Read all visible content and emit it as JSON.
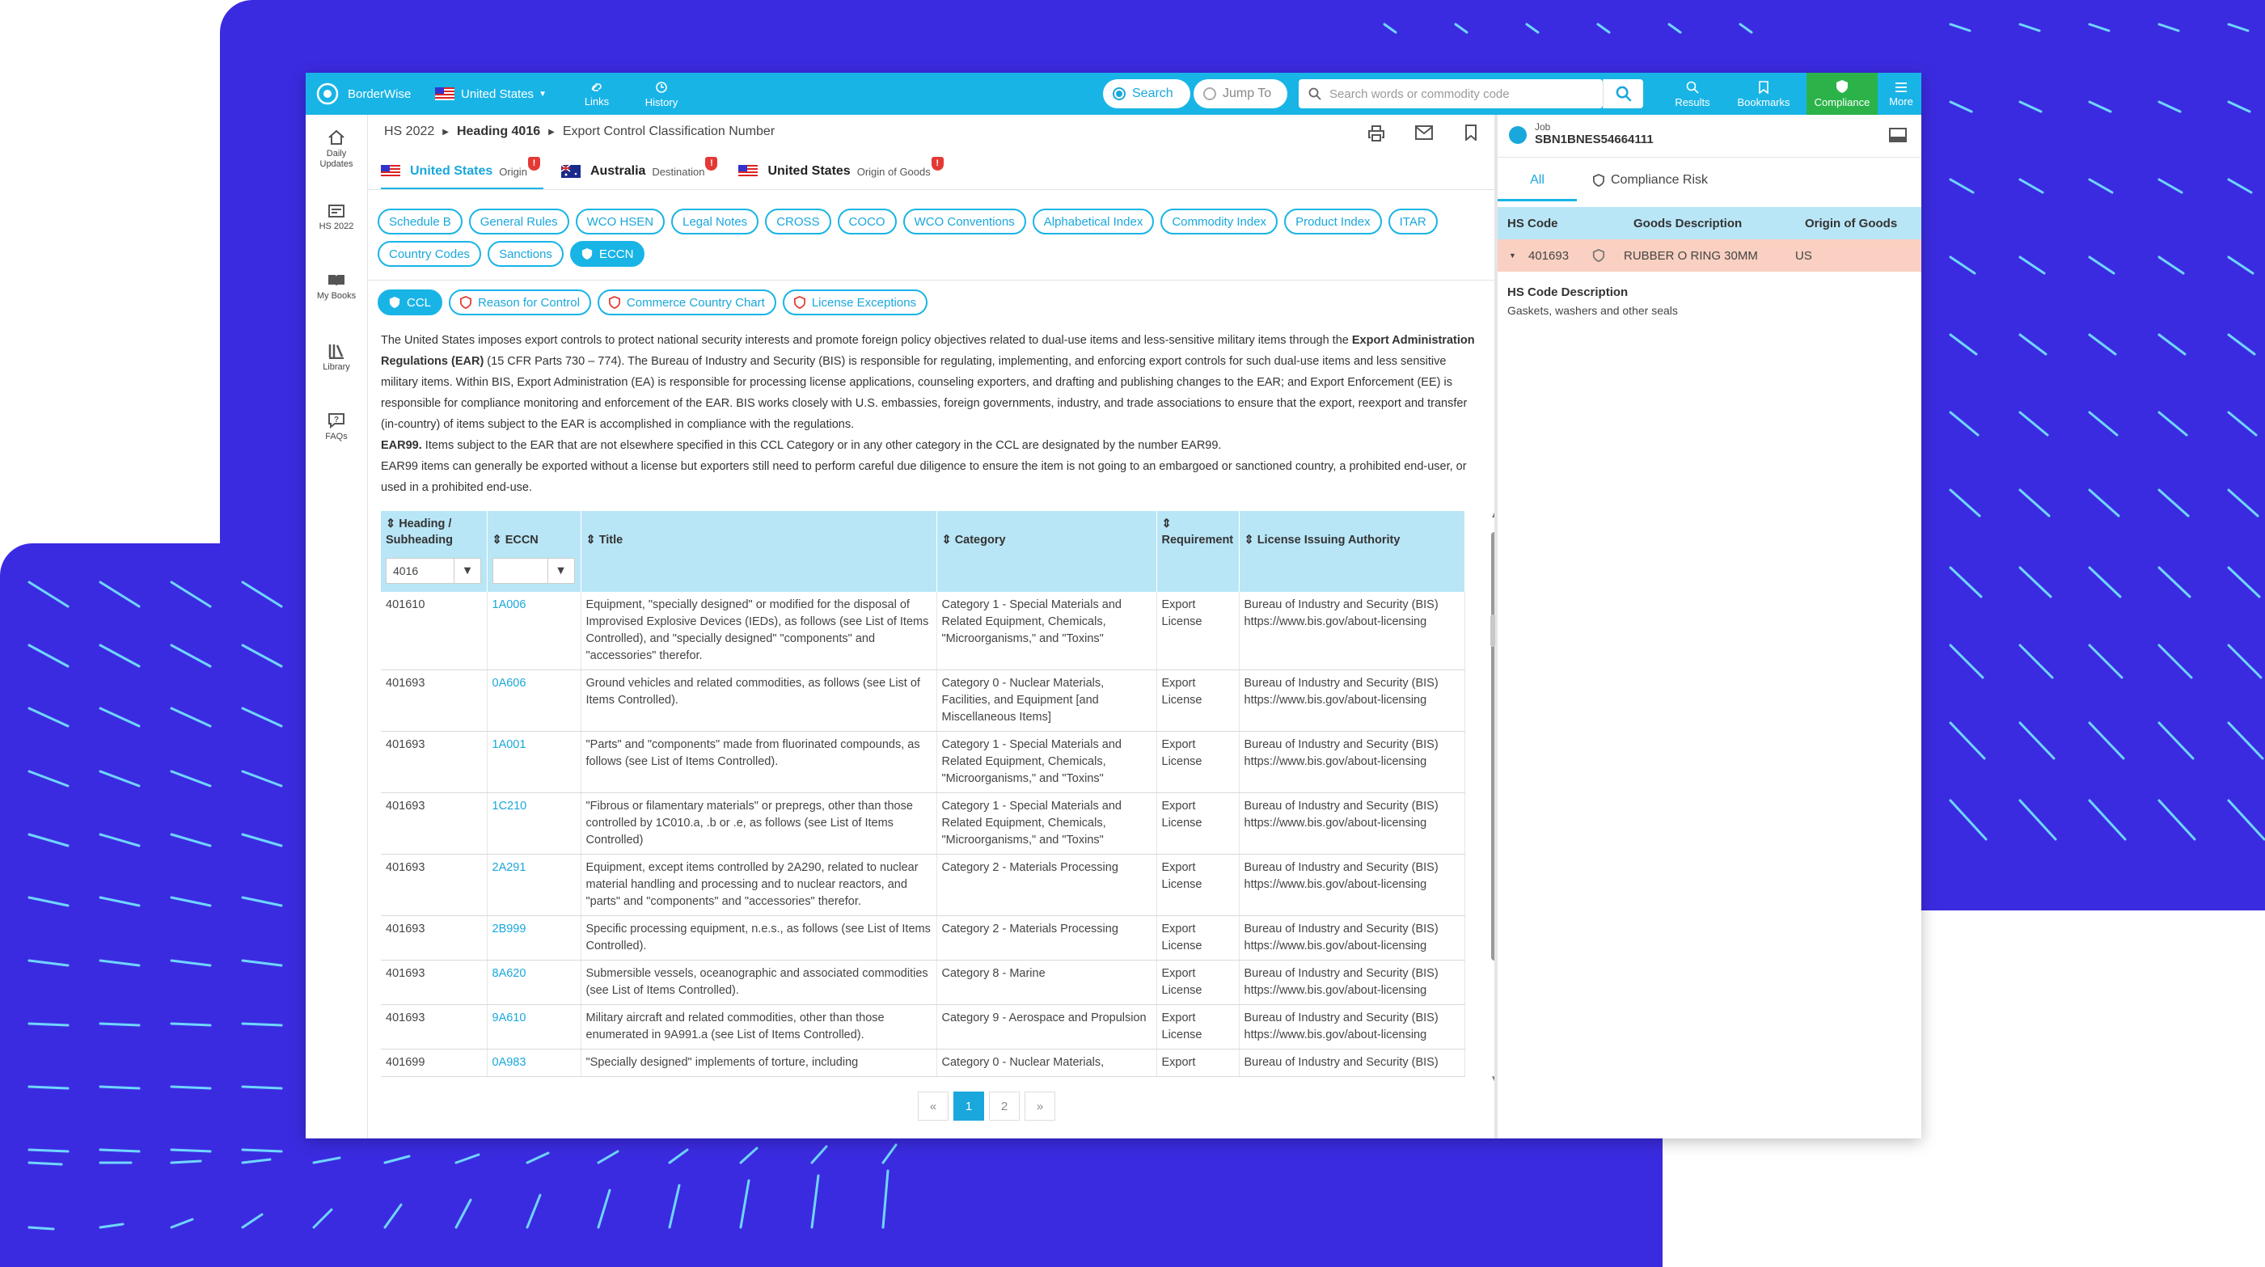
{
  "brand": {
    "name": "BorderWise"
  },
  "topbar": {
    "country": "United States",
    "links": "Links",
    "history": "History",
    "search_radio": "Search",
    "jump_radio": "Jump To",
    "search_placeholder": "Search words or commodity code",
    "results": "Results",
    "bookmarks": "Bookmarks",
    "compliance": "Compliance",
    "more": "More"
  },
  "sidebar": {
    "items": [
      {
        "label": "Daily Updates",
        "icon": "home-icon"
      },
      {
        "label": "HS 2022",
        "icon": "hs-icon"
      },
      {
        "label": "My Books",
        "icon": "book-icon"
      },
      {
        "label": "Library",
        "icon": "library-icon"
      },
      {
        "label": "FAQs",
        "icon": "faq-icon"
      }
    ]
  },
  "breadcrumb": {
    "part1": "HS 2022",
    "part2": "Heading 4016",
    "part3": "Export Control Classification Number"
  },
  "origins": [
    {
      "name": "United States",
      "role": "Origin",
      "badge": "!"
    },
    {
      "name": "Australia",
      "role": "Destination",
      "badge": "!"
    },
    {
      "name": "United States",
      "role": "Origin of Goods",
      "badge": "!"
    }
  ],
  "pills": [
    "Schedule B",
    "General Rules",
    "WCO HSEN",
    "Legal Notes",
    "CROSS",
    "COCO",
    "WCO Conventions",
    "Alphabetical Index",
    "Commodity Index",
    "Product Index",
    "ITAR",
    "Country Codes",
    "Sanctions",
    "ECCN"
  ],
  "subpills": [
    "CCL",
    "Reason for Control",
    "Commerce Country Chart",
    "License Exceptions"
  ],
  "paragraph": {
    "p1a": "The United States imposes export controls to protect national security interests and promote foreign policy objectives related to dual-use items and less-sensitive military items through the ",
    "p1b": "Export Administration Regulations (EAR)",
    "p1c": " (15 CFR Parts 730 – 774). The Bureau of Industry and Security (BIS) is responsible for regulating, implementing, and enforcing export controls for such dual-use items and less sensitive military items. Within BIS, Export Administration (EA) is responsible for processing license applications, counseling exporters, and drafting and publishing changes to the EAR; and Export Enforcement (EE) is responsible for compliance monitoring and enforcement of the EAR. BIS works closely with U.S. embassies, foreign governments, industry, and trade associations to ensure that the export, reexport and transfer (in-country) of items subject to the EAR is accomplished in compliance with the regulations.",
    "p2a": "EAR99.",
    "p2b": " Items subject to the EAR that are not elsewhere specified in this CCL Category or in any other category in the CCL are designated by the number EAR99.",
    "p3": "EAR99 items can generally be exported without a license but exporters still need to perform careful due diligence to ensure the item is not going to an embargoed or sanctioned country, a prohibited end-user, or used in a prohibited end-use."
  },
  "table": {
    "headers": [
      "Heading / Subheading",
      "ECCN",
      "Title",
      "Category",
      "Requirement",
      "License Issuing Authority"
    ],
    "filter_value": "4016",
    "rows": [
      {
        "heading": "401610",
        "eccn": "1A006",
        "title": "Equipment, \"specially designed\" or modified for the disposal of Improvised Explosive Devices (IEDs), as follows (see List of Items Controlled), and \"specially designed\" \"components\" and \"accessories\" therefor.",
        "category": "Category 1 - Special Materials and Related Equipment, Chemicals, \"Microorganisms,\" and \"Toxins\"",
        "req": "Export License",
        "auth": "Bureau of Industry and Security (BIS) https://www.bis.gov/about-licensing"
      },
      {
        "heading": "401693",
        "eccn": "0A606",
        "title": "Ground vehicles and related commodities, as follows (see List of Items Controlled).",
        "category": "Category 0 - Nuclear Materials, Facilities, and Equipment [and Miscellaneous Items]",
        "req": "Export License",
        "auth": "Bureau of Industry and Security (BIS) https://www.bis.gov/about-licensing"
      },
      {
        "heading": "401693",
        "eccn": "1A001",
        "title": "\"Parts\" and \"components\" made from fluorinated compounds, as follows (see List of Items Controlled).",
        "category": "Category 1 - Special Materials and Related Equipment, Chemicals, \"Microorganisms,\" and \"Toxins\"",
        "req": "Export License",
        "auth": "Bureau of Industry and Security (BIS) https://www.bis.gov/about-licensing"
      },
      {
        "heading": "401693",
        "eccn": "1C210",
        "title": "\"Fibrous or filamentary materials\" or prepregs, other than those controlled by 1C010.a, .b or .e, as follows (see List of Items Controlled)",
        "category": "Category 1 - Special Materials and Related Equipment, Chemicals, \"Microorganisms,\" and \"Toxins\"",
        "req": "Export License",
        "auth": "Bureau of Industry and Security (BIS) https://www.bis.gov/about-licensing"
      },
      {
        "heading": "401693",
        "eccn": "2A291",
        "title": "Equipment, except items controlled by 2A290, related to nuclear material handling and processing and to nuclear reactors, and \"parts\" and \"components\" and \"accessories\" therefor.",
        "category": "Category 2 - Materials Processing",
        "req": "Export License",
        "auth": "Bureau of Industry and Security (BIS) https://www.bis.gov/about-licensing"
      },
      {
        "heading": "401693",
        "eccn": "2B999",
        "title": "Specific processing equipment, n.e.s., as follows (see List of Items Controlled).",
        "category": "Category 2 - Materials Processing",
        "req": "Export License",
        "auth": "Bureau of Industry and Security (BIS) https://www.bis.gov/about-licensing"
      },
      {
        "heading": "401693",
        "eccn": "8A620",
        "title": "Submersible vessels, oceanographic and associated commodities (see List of Items Controlled).",
        "category": "Category 8 - Marine",
        "req": "Export License",
        "auth": "Bureau of Industry and Security (BIS) https://www.bis.gov/about-licensing"
      },
      {
        "heading": "401693",
        "eccn": "9A610",
        "title": "Military aircraft and related commodities, other than those enumerated in 9A991.a (see List of Items Controlled).",
        "category": "Category 9 - Aerospace and Propulsion",
        "req": "Export License",
        "auth": "Bureau of Industry and Security (BIS) https://www.bis.gov/about-licensing"
      },
      {
        "heading": "401699",
        "eccn": "0A983",
        "title": "\"Specially designed\" implements of torture, including",
        "category": "Category 0 - Nuclear Materials,",
        "req": "Export",
        "auth": "Bureau of Industry and Security (BIS)"
      }
    ]
  },
  "pager": {
    "prev": "«",
    "pages": [
      "1",
      "2"
    ],
    "next": "»"
  },
  "right_panel": {
    "job_label": "Job",
    "job_id": "SBN1BNES54664111",
    "tabs": [
      "All",
      "Compliance Risk"
    ],
    "headers": [
      "HS Code",
      "Goods Description",
      "Origin of Goods"
    ],
    "row": {
      "code": "401693",
      "desc": "RUBBER O RING 30MM",
      "origin": "US"
    },
    "desc_title": "HS Code Description",
    "desc_text": "Gaskets, washers and other seals"
  },
  "colors": {
    "brand": "#19b4e6",
    "compliance": "#2bb34a",
    "background": "#3b2be0",
    "highlight_row": "#f9d0c1",
    "table_header": "#b9e6f6"
  }
}
